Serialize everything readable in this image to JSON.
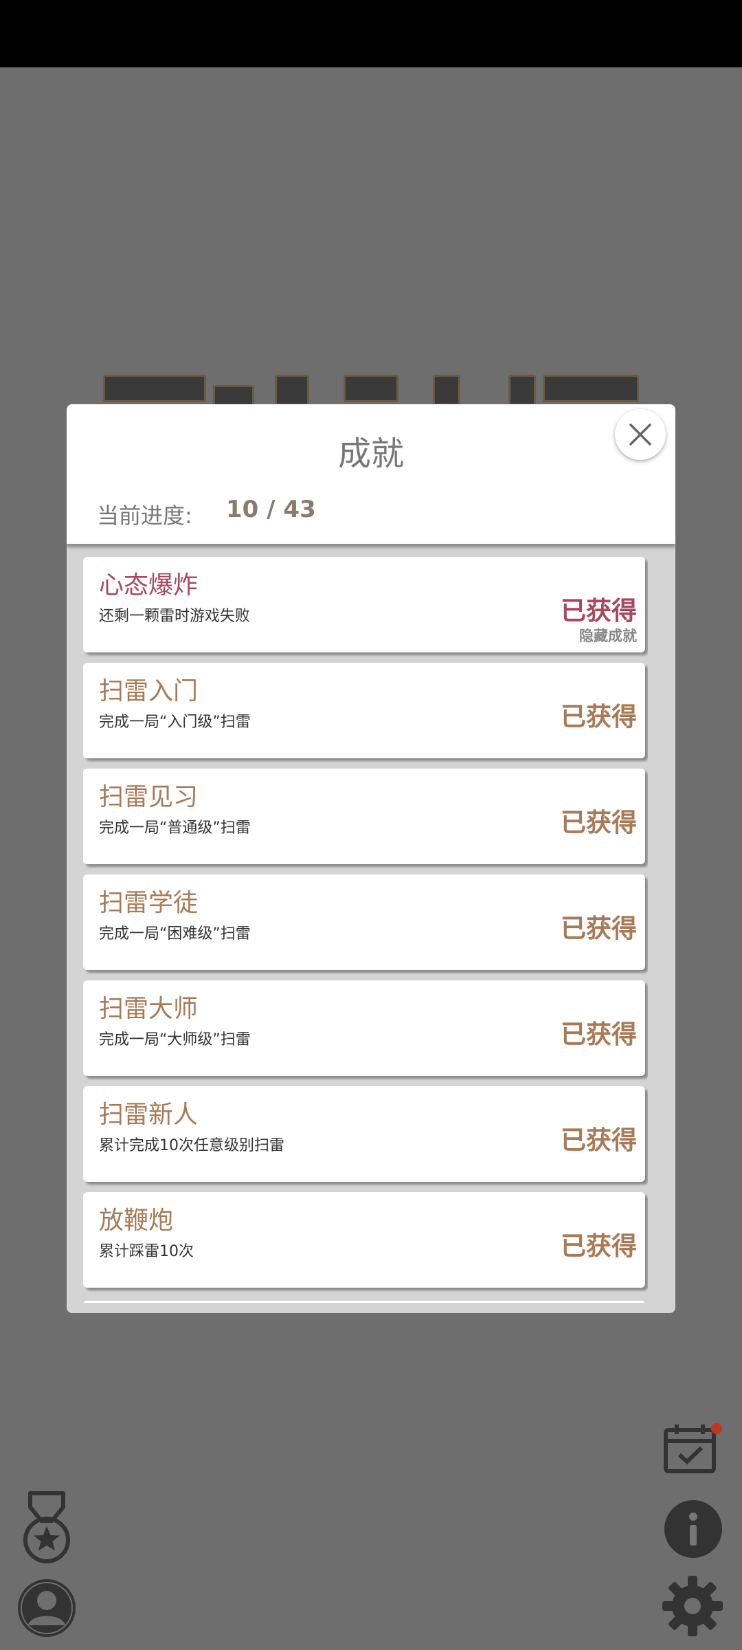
{
  "dialog": {
    "title": "成就",
    "progress_label": "当前进度:",
    "progress_value": "10 / 43"
  },
  "achievements": [
    {
      "title": "心态爆炸",
      "desc": "还剩一颗雷时游戏失败",
      "status": "已获得",
      "tag": "隐藏成就",
      "hidden": true
    },
    {
      "title": "扫雷入门",
      "desc": "完成一局“入门级”扫雷",
      "status": "已获得",
      "tag": "",
      "hidden": false
    },
    {
      "title": "扫雷见习",
      "desc": "完成一局“普通级”扫雷",
      "status": "已获得",
      "tag": "",
      "hidden": false
    },
    {
      "title": "扫雷学徒",
      "desc": "完成一局“困难级”扫雷",
      "status": "已获得",
      "tag": "",
      "hidden": false
    },
    {
      "title": "扫雷大师",
      "desc": "完成一局“大师级”扫雷",
      "status": "已获得",
      "tag": "",
      "hidden": false
    },
    {
      "title": "扫雷新人",
      "desc": "累计完成10次任意级别扫雷",
      "status": "已获得",
      "tag": "",
      "hidden": false
    },
    {
      "title": "放鞭炮",
      "desc": "累计踩雷10次",
      "status": "已获得",
      "tag": "",
      "hidden": false
    }
  ],
  "colors": {
    "accent": "#a87a56",
    "hidden_accent": "#a8485e",
    "overlay": "#6e6e6e",
    "notification_dot": "#c0361f"
  },
  "icons": [
    "close-icon",
    "medal-icon",
    "avatar-icon",
    "calendar-check-icon",
    "info-icon",
    "gear-icon"
  ]
}
